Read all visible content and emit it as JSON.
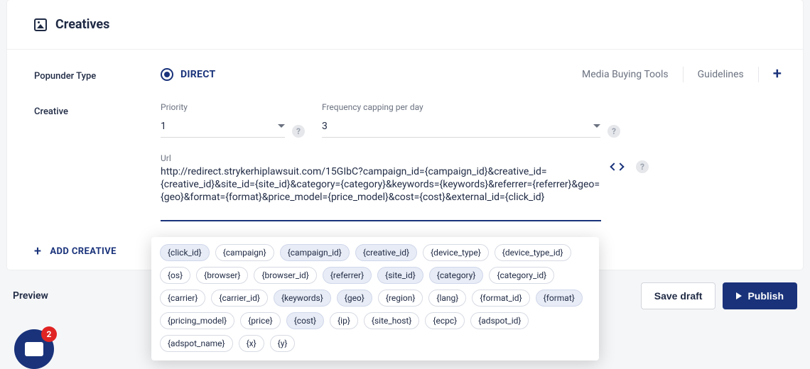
{
  "section": {
    "title": "Creatives"
  },
  "type_row": {
    "label": "Popunder Type",
    "selected": "DIRECT",
    "media_buying": "Media Buying Tools",
    "guidelines": "Guidelines"
  },
  "creative_row": {
    "label": "Creative",
    "priority_label": "Priority",
    "priority_value": "1",
    "freq_label": "Frequency capping per day",
    "freq_value": "3",
    "url_label": "Url",
    "url_value": "http://redirect.strykerhiplawsuit.com/15GIbC?campaign_id={campaign_id}&creative_id={creative_id}&site_id={site_id}&category={category}&keywords={keywords}&referrer={referrer}&geo={geo}&format={format}&price_model={price_model}&cost={cost}&external_id={click_id}"
  },
  "add_creative": "ADD CREATIVE",
  "footer": {
    "preview": "Preview",
    "save_draft": "Save draft",
    "publish": "Publish"
  },
  "tokens": [
    {
      "label": "{click_id}",
      "active": true
    },
    {
      "label": "{campaign}",
      "active": false
    },
    {
      "label": "{campaign_id}",
      "active": true
    },
    {
      "label": "{creative_id}",
      "active": true
    },
    {
      "label": "{device_type}",
      "active": false
    },
    {
      "label": "{device_type_id}",
      "active": false
    },
    {
      "label": "{os}",
      "active": false
    },
    {
      "label": "{browser}",
      "active": false
    },
    {
      "label": "{browser_id}",
      "active": false
    },
    {
      "label": "{referrer}",
      "active": true
    },
    {
      "label": "{site_id}",
      "active": true
    },
    {
      "label": "{category}",
      "active": true
    },
    {
      "label": "{category_id}",
      "active": false
    },
    {
      "label": "{carrier}",
      "active": false
    },
    {
      "label": "{carrier_id}",
      "active": false
    },
    {
      "label": "{keywords}",
      "active": true
    },
    {
      "label": "{geo}",
      "active": true
    },
    {
      "label": "{region}",
      "active": false
    },
    {
      "label": "{lang}",
      "active": false
    },
    {
      "label": "{format_id}",
      "active": false
    },
    {
      "label": "{format}",
      "active": true
    },
    {
      "label": "{pricing_model}",
      "active": false
    },
    {
      "label": "{price}",
      "active": false
    },
    {
      "label": "{cost}",
      "active": true
    },
    {
      "label": "{ip}",
      "active": false
    },
    {
      "label": "{site_host}",
      "active": false
    },
    {
      "label": "{ecpc}",
      "active": false
    },
    {
      "label": "{adspot_id}",
      "active": false
    },
    {
      "label": "{adspot_name}",
      "active": false
    },
    {
      "label": "{x}",
      "active": false
    },
    {
      "label": "{y}",
      "active": false
    }
  ],
  "chat_badge": "2"
}
